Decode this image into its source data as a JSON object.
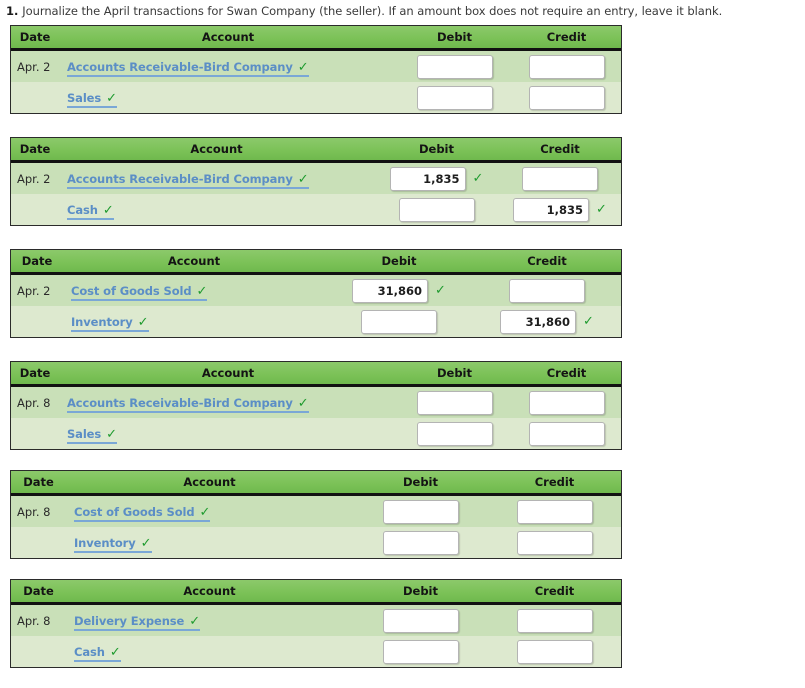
{
  "prompt": {
    "number": "1.",
    "text": "Journalize the April transactions for Swan Company (the seller). If an amount box does not require an entry, leave it blank."
  },
  "columns": {
    "date": "Date",
    "account": "Account",
    "debit": "Debit",
    "credit": "Credit"
  },
  "icons": {
    "check": "✓"
  },
  "colors": {
    "header_green": "#7cc258",
    "row_odd": "#c9e0b8",
    "row_even": "#dde9cf",
    "link_blue": "#5b8ec6",
    "check_green": "#1f9b2f"
  },
  "journals": [
    {
      "id": "journal-1",
      "layout": {
        "date_w": 48,
        "account_w": 338,
        "debit_w": 115,
        "credit_w": 109
      },
      "rows": [
        {
          "date": "Apr. 2",
          "account": "Accounts Receivable-Bird Company",
          "account_checked": true,
          "debit": "",
          "debit_checked": false,
          "credit": "",
          "credit_checked": false
        },
        {
          "date": "",
          "account": "Sales",
          "account_checked": true,
          "debit": "",
          "debit_checked": false,
          "credit": "",
          "credit_checked": false
        }
      ]
    },
    {
      "id": "journal-2",
      "layout": {
        "date_w": 48,
        "account_w": 315,
        "debit_w": 125,
        "credit_w": 122
      },
      "rows": [
        {
          "date": "Apr. 2",
          "account": "Accounts Receivable-Bird Company",
          "account_checked": true,
          "debit": "1,835",
          "debit_checked": true,
          "credit": "",
          "credit_checked": false
        },
        {
          "date": "",
          "account": "Cash",
          "account_checked": true,
          "debit": "",
          "debit_checked": false,
          "credit": "1,835",
          "credit_checked": true
        }
      ]
    },
    {
      "id": "journal-3",
      "layout": {
        "date_w": 52,
        "account_w": 262,
        "debit_w": 148,
        "credit_w": 148
      },
      "rows": [
        {
          "date": "Apr. 2",
          "account": "Cost of Goods Sold",
          "account_checked": true,
          "debit": "31,860",
          "debit_checked": true,
          "credit": "",
          "credit_checked": false
        },
        {
          "date": "",
          "account": "Inventory",
          "account_checked": true,
          "debit": "",
          "debit_checked": false,
          "credit": "31,860",
          "credit_checked": true
        }
      ]
    },
    {
      "id": "journal-4",
      "layout": {
        "date_w": 48,
        "account_w": 338,
        "debit_w": 115,
        "credit_w": 109
      },
      "rows": [
        {
          "date": "Apr. 8",
          "account": "Accounts Receivable-Bird Company",
          "account_checked": true,
          "debit": "",
          "debit_checked": false,
          "credit": "",
          "credit_checked": false
        },
        {
          "date": "",
          "account": "Sales",
          "account_checked": true,
          "debit": "",
          "debit_checked": false,
          "credit": "",
          "credit_checked": false
        }
      ]
    },
    {
      "id": "journal-5",
      "layout": {
        "date_w": 55,
        "account_w": 287,
        "debit_w": 135,
        "credit_w": 133
      },
      "rows": [
        {
          "date": "Apr. 8",
          "account": "Cost of Goods Sold",
          "account_checked": true,
          "debit": "",
          "debit_checked": false,
          "credit": "",
          "credit_checked": false
        },
        {
          "date": "",
          "account": "Inventory",
          "account_checked": true,
          "debit": "",
          "debit_checked": false,
          "credit": "",
          "credit_checked": false
        }
      ]
    },
    {
      "id": "journal-6",
      "layout": {
        "date_w": 55,
        "account_w": 287,
        "debit_w": 135,
        "credit_w": 133
      },
      "rows": [
        {
          "date": "Apr. 8",
          "account": "Delivery Expense",
          "account_checked": true,
          "debit": "",
          "debit_checked": false,
          "credit": "",
          "credit_checked": false
        },
        {
          "date": "",
          "account": "Cash",
          "account_checked": true,
          "debit": "",
          "debit_checked": false,
          "credit": "",
          "credit_checked": false
        }
      ]
    }
  ]
}
